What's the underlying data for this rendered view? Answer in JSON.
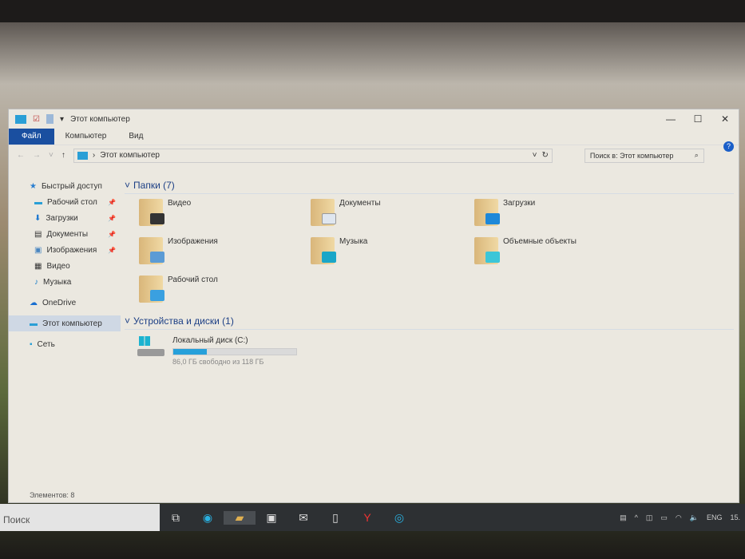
{
  "window": {
    "title": "Этот компьютер",
    "minimize": "—",
    "maximize": "☐",
    "close": "✕"
  },
  "ribbon": {
    "tabs": [
      "Файл",
      "Компьютер",
      "Вид"
    ],
    "help": "?"
  },
  "address": {
    "path": "Этот компьютер",
    "search_placeholder": "Поиск в: Этот компьютер"
  },
  "nav": [
    {
      "label": "Быстрый доступ",
      "icon": "star-icon"
    },
    {
      "label": "Рабочий стол",
      "icon": "desktop-icon",
      "pinned": true
    },
    {
      "label": "Загрузки",
      "icon": "download-icon",
      "pinned": true
    },
    {
      "label": "Документы",
      "icon": "document-icon",
      "pinned": true
    },
    {
      "label": "Изображения",
      "icon": "image-icon",
      "pinned": true
    },
    {
      "label": "Видео",
      "icon": "video-icon"
    },
    {
      "label": "Музыка",
      "icon": "music-icon"
    },
    {
      "label": "OneDrive",
      "icon": "cloud-icon"
    },
    {
      "label": "Этот компьютер",
      "icon": "computer-icon",
      "selected": true
    },
    {
      "label": "Сеть",
      "icon": "network-icon"
    }
  ],
  "folders_group": "Папки (7)",
  "folders": [
    {
      "name": "Видео",
      "color": "#333"
    },
    {
      "name": "Документы",
      "color": "#dfe6ef"
    },
    {
      "name": "Загрузки",
      "color": "#1e88d8"
    },
    {
      "name": "Изображения",
      "color": "#5b9bd5"
    },
    {
      "name": "Музыка",
      "color": "#1aa6c8"
    },
    {
      "name": "Объемные объекты",
      "color": "#3cc6d8"
    },
    {
      "name": "Рабочий стол",
      "color": "#3aa0e0"
    }
  ],
  "drives_group": "Устройства и диски (1)",
  "drive": {
    "name": "Локальный диск (C:)",
    "free_text": "86,0 ГБ свободно из 118 ГБ",
    "used_fraction": 0.27
  },
  "status": "Элементов: 8",
  "taskbar": {
    "search": "Поиск",
    "lang": "ENG",
    "clock": "15."
  }
}
